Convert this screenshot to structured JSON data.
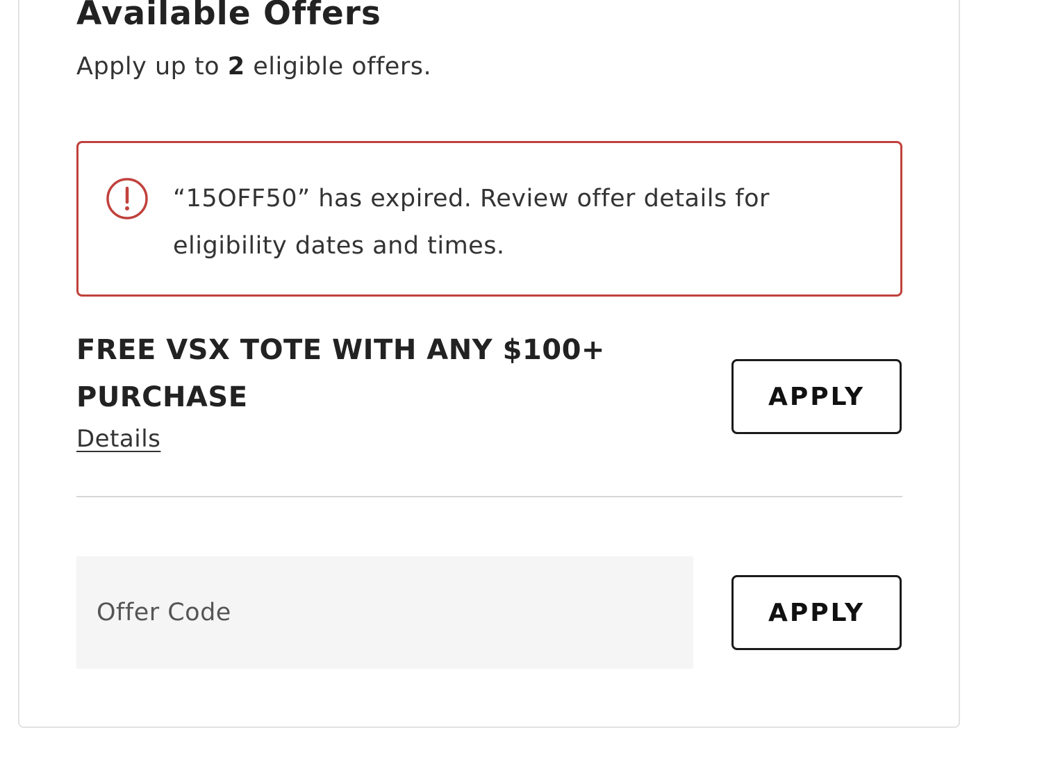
{
  "offers_panel": {
    "title": "Available Offers",
    "subtitle_prefix": "Apply up to ",
    "max_offers": "2",
    "subtitle_suffix": " eligible offers."
  },
  "error_alert": {
    "icon": "exclamation-circle-icon",
    "message": "“15OFF50” has expired. Review offer details for eligibility dates and times.",
    "border_color": "#c0413c"
  },
  "offer": {
    "title": "FREE VSX TOTE WITH ANY $100+ PURCHASE",
    "details_label": "Details",
    "apply_label": "APPLY"
  },
  "offer_code": {
    "placeholder": "Offer Code",
    "value": "",
    "apply_label": "APPLY"
  }
}
